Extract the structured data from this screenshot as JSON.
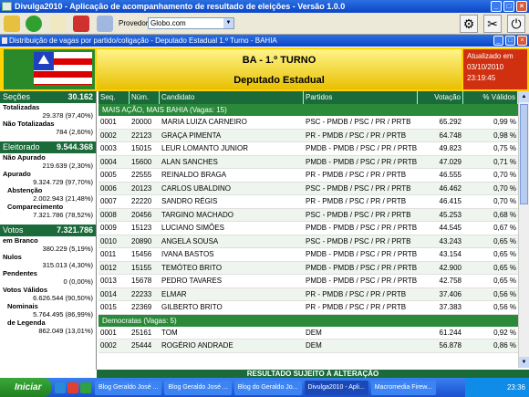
{
  "window": {
    "title": "Divulga2010 - Aplicação de acompanhamento de resultado de eleições - Versão 1.0.0"
  },
  "toolbar": {
    "provider_label": "Provedor:",
    "provider_value": "Globo.com"
  },
  "subwindow": {
    "title": "Distribuição de vagas por partido/coligação - Deputado Estadual 1.º Turno - BAHIA"
  },
  "header": {
    "line1": "BA - 1.º TURNO",
    "line2": "Deputado Estadual",
    "updated_label": "Atualizado em",
    "updated_date": "03/10/2010",
    "updated_time": "23:19:45"
  },
  "left": {
    "secoes_label": "Seções",
    "secoes_value": "30.162",
    "totalizadas_label": "Totalizadas",
    "totalizadas_value": "29.378 (97,40%)",
    "nao_totalizadas_label": "Não Totalizadas",
    "nao_totalizadas_value": "784 (2,60%)",
    "eleitorado_label": "Eleitorado",
    "eleitorado_value": "9.544.368",
    "nao_apurado_label": "Não Apurado",
    "nao_apurado_value": "219.639 (2,30%)",
    "apurado_label": "Apurado",
    "apurado_value": "9.324.729 (97,70%)",
    "abstencao_label": "Abstenção",
    "abstencao_value": "2.002.943 (21,48%)",
    "comparecimento_label": "Comparecimento",
    "comparecimento_value": "7.321.786 (78,52%)",
    "votos_label": "Votos",
    "votos_value": "7.321.786",
    "branco_label": "em Branco",
    "branco_value": "380.229 (5,19%)",
    "nulos_label": "Nulos",
    "nulos_value": "315.013 (4,30%)",
    "pendentes_label": "Pendentes",
    "pendentes_value": "0 (0,00%)",
    "validos_label": "Votos Válidos",
    "validos_value": "6.626.544 (90,50%)",
    "nominais_label": "Nominais",
    "nominais_value": "5.764.495 (86,99%)",
    "legenda_label": "de Legenda",
    "legenda_value": "862.049 (13,01%)"
  },
  "table": {
    "headers": [
      "Seq.",
      "Núm.",
      "Candidato",
      "Partidos",
      "Votação",
      "% Válidos"
    ],
    "group1": "MAIS AÇÃO, MAIS BAHIA   (Vagas: 15)",
    "group2": "Democratas   (Vagas: 5)",
    "rows": [
      [
        "0001",
        "20000",
        "MARIA LUIZA CARNEIRO",
        "PSC - PMDB / PSC / PR / PRTB",
        "65.292",
        "0,99 %"
      ],
      [
        "0002",
        "22123",
        "GRAÇA PIMENTA",
        "PR - PMDB / PSC / PR / PRTB",
        "64.748",
        "0,98 %"
      ],
      [
        "0003",
        "15015",
        "LEUR LOMANTO JUNIOR",
        "PMDB - PMDB / PSC / PR / PRTB",
        "49.823",
        "0,75 %"
      ],
      [
        "0004",
        "15600",
        "ALAN SANCHES",
        "PMDB - PMDB / PSC / PR / PRTB",
        "47.029",
        "0,71 %"
      ],
      [
        "0005",
        "22555",
        "REINALDO BRAGA",
        "PR - PMDB / PSC / PR / PRTB",
        "46.555",
        "0,70 %"
      ],
      [
        "0006",
        "20123",
        "CARLOS UBALDINO",
        "PSC - PMDB / PSC / PR / PRTB",
        "46.462",
        "0,70 %"
      ],
      [
        "0007",
        "22220",
        "SANDRO RÉGIS",
        "PR - PMDB / PSC / PR / PRTB",
        "46.415",
        "0,70 %"
      ],
      [
        "0008",
        "20456",
        "TARGINO MACHADO",
        "PSC - PMDB / PSC / PR / PRTB",
        "45.253",
        "0,68 %"
      ],
      [
        "0009",
        "15123",
        "LUCIANO SIMÕES",
        "PMDB - PMDB / PSC / PR / PRTB",
        "44.545",
        "0,67 %"
      ],
      [
        "0010",
        "20890",
        "ANGELA SOUSA",
        "PSC - PMDB / PSC / PR / PRTB",
        "43.243",
        "0,65 %"
      ],
      [
        "0011",
        "15456",
        "IVANA BASTOS",
        "PMDB - PMDB / PSC / PR / PRTB",
        "43.154",
        "0,65 %"
      ],
      [
        "0012",
        "15155",
        "TEMÓTEO BRITO",
        "PMDB - PMDB / PSC / PR / PRTB",
        "42.900",
        "0,65 %"
      ],
      [
        "0013",
        "15678",
        "PEDRO TAVARES",
        "PMDB - PMDB / PSC / PR / PRTB",
        "42.758",
        "0,65 %"
      ],
      [
        "0014",
        "22233",
        "ELMAR",
        "PR - PMDB / PSC / PR / PRTB",
        "37.406",
        "0,56 %"
      ],
      [
        "0015",
        "22369",
        "GILBERTO BRITO",
        "PR - PMDB / PSC / PR / PRTB",
        "37.383",
        "0,56 %"
      ]
    ],
    "rows2": [
      [
        "0001",
        "25161",
        "TOM",
        "DEM",
        "61.244",
        "0,92 %"
      ],
      [
        "0002",
        "25444",
        "ROGÉRIO ANDRADE",
        "DEM",
        "56.878",
        "0,86 %"
      ]
    ]
  },
  "footer": {
    "text": "RESULTADO SUJEITO À ALTERAÇÃO"
  },
  "taskbar": {
    "start": "Iniciar",
    "tasks": [
      "Blog Geraldo José ...",
      "Blog Geraldo José ...",
      "Blog do Geraldo Jo...",
      "Divulga2010 - Apli...",
      "Macromedia Firew..."
    ],
    "clock": "23:36"
  }
}
